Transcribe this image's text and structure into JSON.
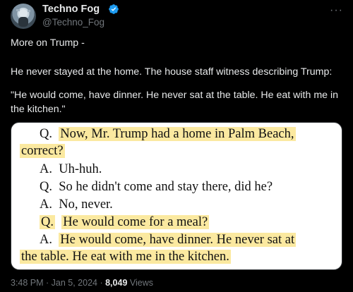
{
  "author": {
    "name": "Techno Fog",
    "handle": "@Techno_Fog"
  },
  "colors": {
    "background": "#000000",
    "text": "#e7e9ea",
    "muted": "#71767b",
    "verified": "#1d9bf0",
    "highlight": "#fbe9a0"
  },
  "post": {
    "line1": "More on Trump -",
    "line2": "He never stayed at the home. The house staff witness describing Trump:",
    "line3": "\"He would come, have dinner. He never sat at the table. He eat with me in the kitchen.\""
  },
  "transcript": {
    "q1_label": "Q.",
    "q1_text": "Now, Mr. Trump had a home in Palm Beach,",
    "q1_cont": "correct?",
    "a1_label": "A.",
    "a1_text": "Uh-huh.",
    "q2_label": "Q.",
    "q2_text": "So he didn't come and stay there, did he?",
    "a2_label": "A.",
    "a2_text": "No, never.",
    "q3_label": "Q.",
    "q3_text": "He would come for a meal?",
    "a3_label": "A.",
    "a3_text": "He would come, have dinner.  He never sat at",
    "a3_cont": "the table.  He eat with me in the kitchen."
  },
  "meta": {
    "time": "3:48 PM · Jan 5, 2024 · ",
    "views_count": "8,049",
    "views_label": " Views"
  },
  "icons": {
    "more": "more-icon",
    "verified": "verified-badge-icon",
    "avatar": "avatar-image"
  }
}
